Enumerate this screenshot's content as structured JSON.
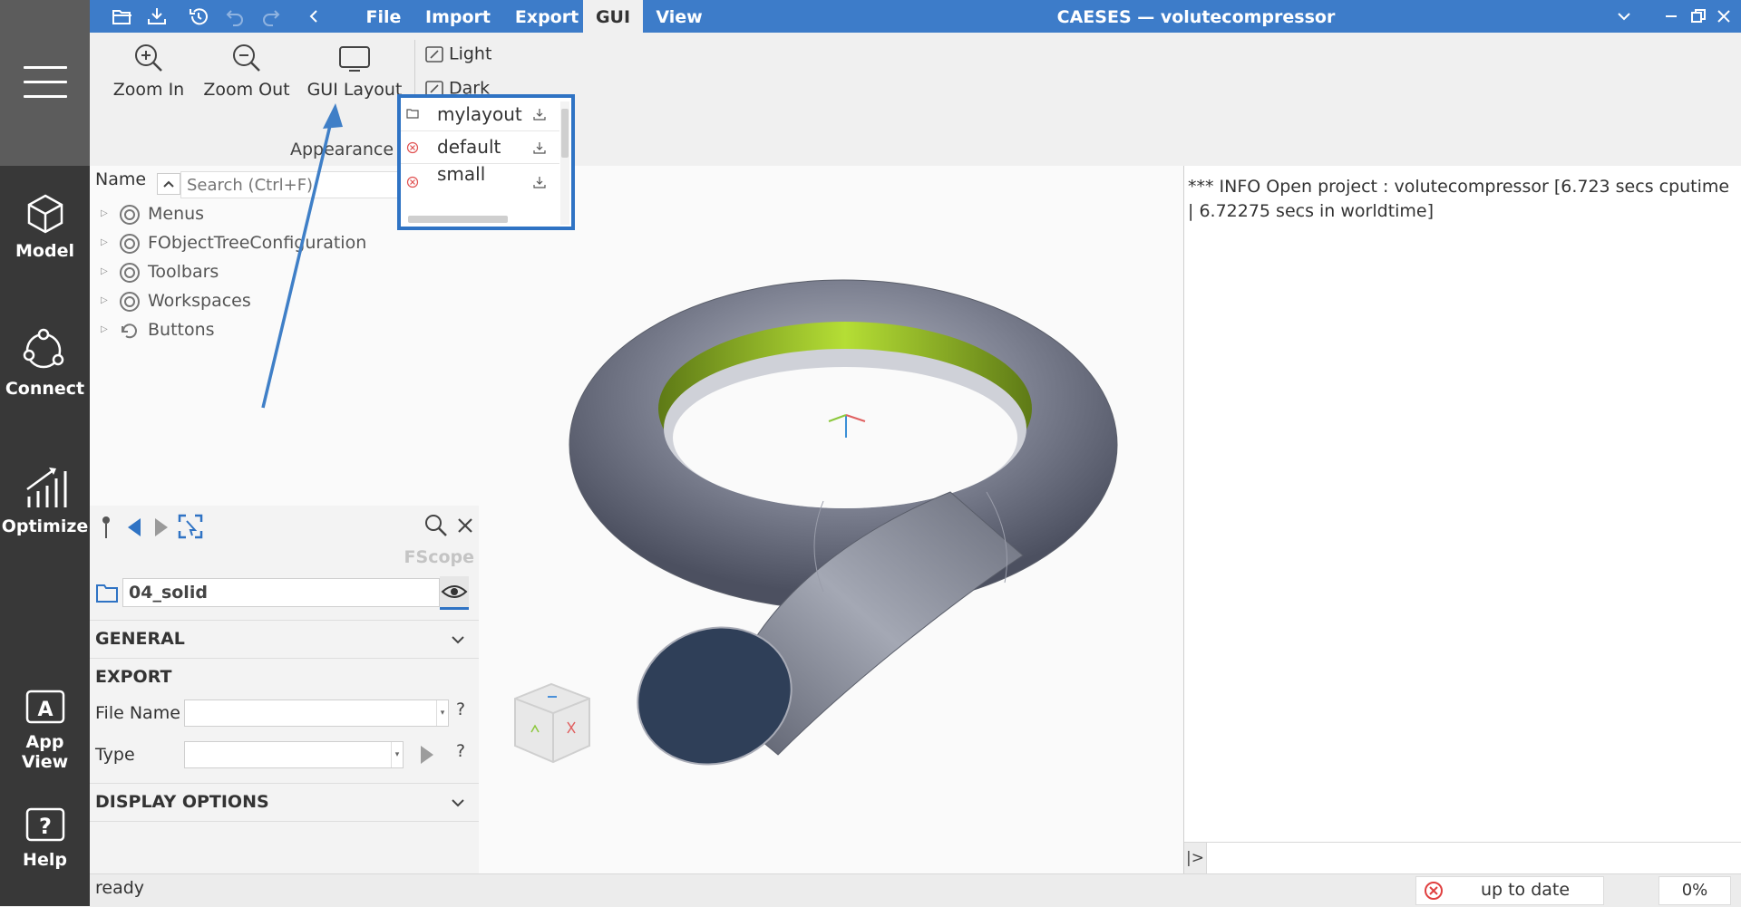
{
  "window": {
    "title": "CAESES — volutecompressor",
    "menus": [
      "File",
      "Import",
      "Export",
      "GUI",
      "View"
    ],
    "active_menu": "GUI"
  },
  "left_nav": {
    "items": [
      {
        "label": "Model",
        "icon": "cube-icon"
      },
      {
        "label": "Connect",
        "icon": "network-icon"
      },
      {
        "label": "Optimize",
        "icon": "chart-icon"
      },
      {
        "label": "App View",
        "icon": "app-view-icon"
      },
      {
        "label": "Help",
        "icon": "help-icon"
      }
    ]
  },
  "ribbon": {
    "zoom_in": "Zoom In",
    "zoom_out": "Zoom Out",
    "gui_layout": "GUI Layout",
    "light": "Light",
    "dark": "Dark",
    "group_label": "Appearance"
  },
  "layout_popup": {
    "items": [
      {
        "name": "mylayout",
        "icon": "folder-icon"
      },
      {
        "name": "default",
        "icon": "delete-icon"
      },
      {
        "name": "small",
        "icon": "delete-icon"
      }
    ]
  },
  "tree": {
    "column_header": "Name",
    "search_placeholder": "Search (Ctrl+F)",
    "items": [
      {
        "label": "Menus"
      },
      {
        "label": "FObjectTreeConfiguration"
      },
      {
        "label": "Toolbars"
      },
      {
        "label": "Workspaces"
      },
      {
        "label": "Buttons"
      }
    ]
  },
  "properties": {
    "scope_label": "FScope",
    "object_name": "04_solid",
    "sections": {
      "general": "GENERAL",
      "export": "EXPORT",
      "display_options": "DISPLAY OPTIONS"
    },
    "fields": {
      "file_name": "File Name",
      "type": "Type",
      "help": "?"
    }
  },
  "console": {
    "message": "*** INFO Open project : volutecompressor [6.723 secs cputime | 6.72275 secs in worldtime]",
    "prompt": "|>"
  },
  "status": {
    "left": "ready",
    "sync_state": "up to date",
    "progress": "0%"
  },
  "colors": {
    "titlebar": "#3d7cc9",
    "dock": "#383838",
    "popup_border": "#2f73c4",
    "annotation_arrow": "#3f7fc7"
  }
}
